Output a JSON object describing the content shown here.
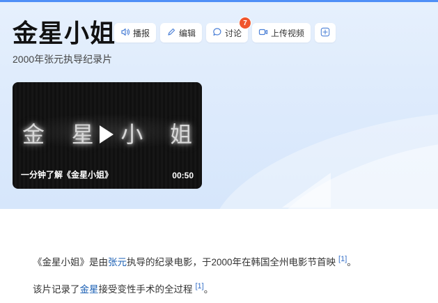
{
  "header": {
    "title": "金星小姐",
    "subtitle": "2000年张元执导纪录片"
  },
  "actions": {
    "broadcast_label": "播报",
    "edit_label": "编辑",
    "discuss_label": "讨论",
    "discuss_badge": "7",
    "upload_video_label": "上传视频"
  },
  "video": {
    "overlay_chars": [
      "金",
      "星",
      "小",
      "姐"
    ],
    "caption": "一分钟了解《金星小姐》",
    "duration": "00:50"
  },
  "content": {
    "p1": {
      "before": "《金星小姐》是由",
      "link": "张元",
      "after": "执导的纪录电影，于2000年在韩国全州电影节首映",
      "ref": "[1]",
      "end": "。"
    },
    "p2": {
      "before": "该片记录了",
      "link": "金星",
      "after": "接受变性手术的全过程",
      "ref": "[1]",
      "end": "。"
    }
  },
  "colors": {
    "accent": "#4f8ff7",
    "badge": "#f0552d",
    "link": "#1a5fb4"
  }
}
